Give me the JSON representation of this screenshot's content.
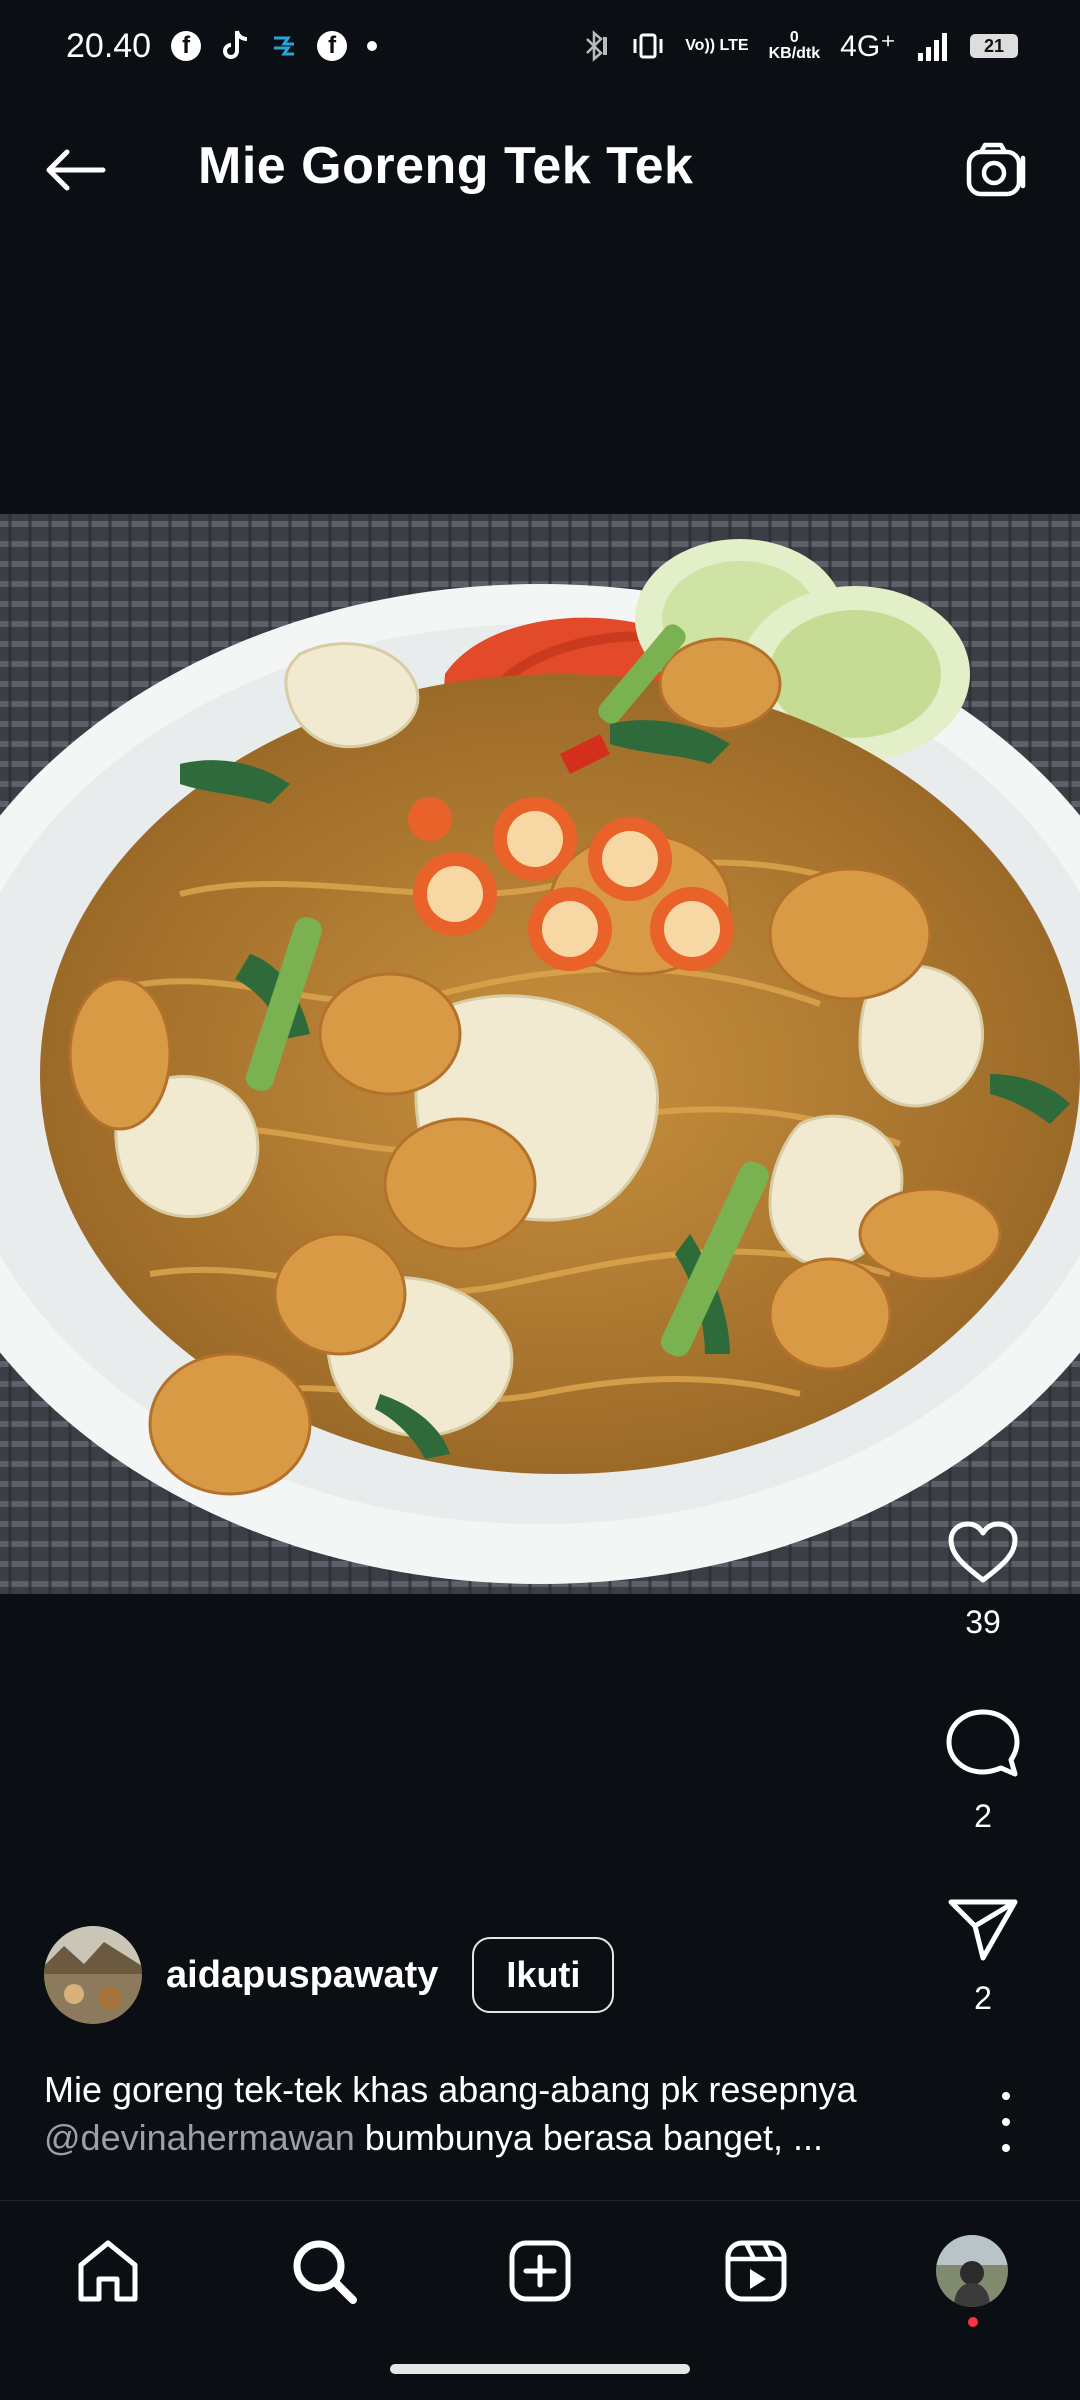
{
  "status_bar": {
    "time": "20.40",
    "network": "4G⁺",
    "data_speed_top": "0",
    "data_speed_unit": "KB/dtk",
    "volte": "Vo)) LTE",
    "battery": "21"
  },
  "header": {
    "title": "Mie Goreng Tek Tek"
  },
  "post": {
    "likes": "39",
    "comments": "2",
    "shares": "2",
    "username": "aidapuspawaty",
    "follow_label": "Ikuti",
    "caption_line1": "Mie goreng tek-tek khas abang-abang pk resepnya",
    "mention": "@devinahermawan",
    "caption_line2": " bumbunya berasa banget, ..."
  },
  "nav": {
    "items": [
      "home",
      "search",
      "create",
      "reels",
      "profile"
    ]
  },
  "colors": {
    "background": "#0b0f14",
    "mention": "#9aa0a6",
    "notification": "#ff3040"
  }
}
